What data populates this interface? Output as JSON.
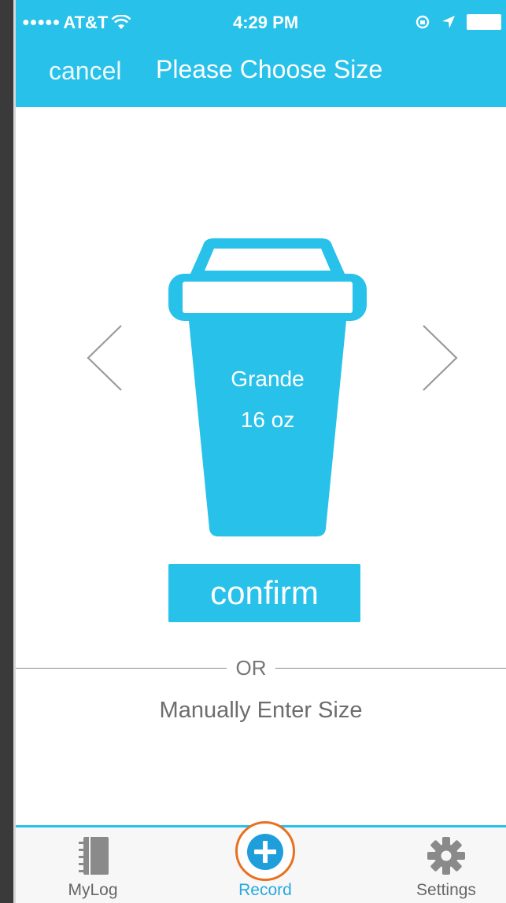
{
  "status_bar": {
    "signal": "●●●●●",
    "carrier": "AT&T",
    "time": "4:29 PM"
  },
  "nav": {
    "cancel_label": "cancel",
    "title": "Please Choose Size"
  },
  "size_picker": {
    "size_name": "Grande",
    "size_amount": "16 oz",
    "cup_color": "#27c1ea"
  },
  "confirm_label": "confirm",
  "divider_text": "OR",
  "manual_entry_label": "Manually Enter Size",
  "tabs": [
    {
      "label": "MyLog",
      "icon": "notebook-icon"
    },
    {
      "label": "Record",
      "icon": "plus-icon"
    },
    {
      "label": "Settings",
      "icon": "gear-icon"
    }
  ],
  "colors": {
    "accent": "#27c1ea",
    "record_ring": "#e8701e"
  }
}
